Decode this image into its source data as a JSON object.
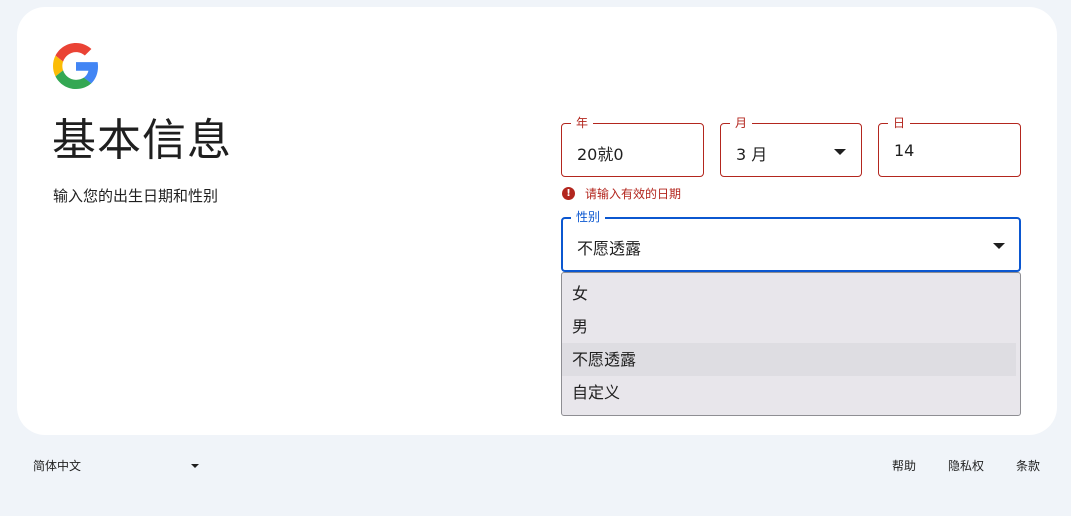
{
  "page": {
    "title": "基本信息",
    "subtitle": "输入您的出生日期和性别"
  },
  "birthdate": {
    "year": {
      "label": "年",
      "value": "20就0"
    },
    "month": {
      "label": "月",
      "value": "3 月"
    },
    "day": {
      "label": "日",
      "value": "14"
    },
    "error": "请输入有效的日期"
  },
  "gender": {
    "label": "性别",
    "value": "不愿透露",
    "options": [
      "女",
      "男",
      "不愿透露",
      "自定义"
    ],
    "selected_index": 2
  },
  "footer": {
    "language": "简体中文",
    "help": "帮助",
    "privacy": "隐私权",
    "terms": "条款"
  },
  "colors": {
    "error": "#b3261e",
    "focus": "#0b57d0",
    "background": "#f0f4f9"
  }
}
